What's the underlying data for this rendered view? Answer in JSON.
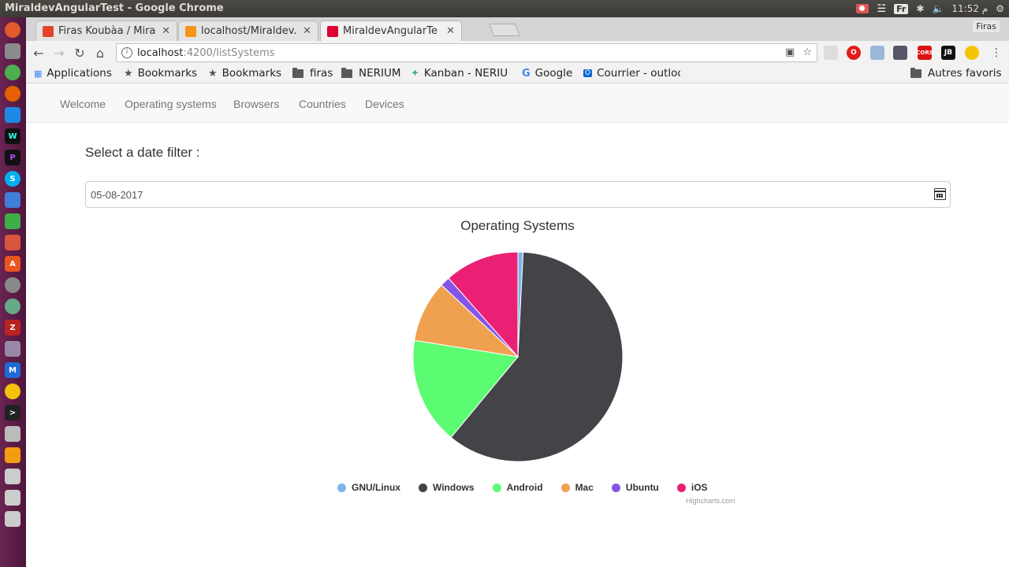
{
  "system": {
    "window_title": "MiraldevAngularTest - Google Chrome",
    "time": "11:52 م",
    "keyboard_layout": "Fr"
  },
  "browser": {
    "tabs": [
      {
        "title": "Firas Koubàa / Mira",
        "icon": "gitlab-icon",
        "active": false
      },
      {
        "title": "localhost/Miraldev.",
        "icon": "xampp-icon",
        "active": false
      },
      {
        "title": "MiraldevAngularTe",
        "icon": "angular-icon",
        "active": true
      }
    ],
    "profile_name": "Firas",
    "url_host": "localhost",
    "url_path": ":4200/listSystems",
    "bookmarks": [
      {
        "label": "Applications",
        "icon": "apps-grid-icon"
      },
      {
        "label": "Bookmarks",
        "icon": "star-icon"
      },
      {
        "label": "Bookmarks",
        "icon": "star-icon"
      },
      {
        "label": "firas",
        "icon": "folder-icon"
      },
      {
        "label": "NERIUM",
        "icon": "folder-icon"
      },
      {
        "label": "Kanban - NERIUM",
        "icon": "kanban-icon"
      },
      {
        "label": "Google",
        "icon": "google-icon"
      },
      {
        "label": "Courrier - outlook",
        "icon": "outlook-icon"
      }
    ],
    "other_bookmarks": "Autres favoris"
  },
  "app": {
    "nav": [
      "Welcome",
      "Operating systems",
      "Browsers",
      "Countries",
      "Devices"
    ],
    "filter_label": "Select a date filter :",
    "date_value": "05-08-2017",
    "credits": "Highcharts.com"
  },
  "chart_data": {
    "type": "pie",
    "title": "Operating Systems",
    "legend_position": "bottom-center",
    "series": [
      {
        "name": "GNU/Linux",
        "value": 0.8,
        "color": "#7cb5ec"
      },
      {
        "name": "Windows",
        "value": 60.2,
        "color": "#434348"
      },
      {
        "name": "Android",
        "value": 16.5,
        "color": "#5cfc72"
      },
      {
        "name": "Mac",
        "value": 9.5,
        "color": "#f0a14f"
      },
      {
        "name": "Ubuntu",
        "value": 1.5,
        "color": "#8555e5"
      },
      {
        "name": "iOS",
        "value": 11.5,
        "color": "#ea2074"
      }
    ]
  }
}
